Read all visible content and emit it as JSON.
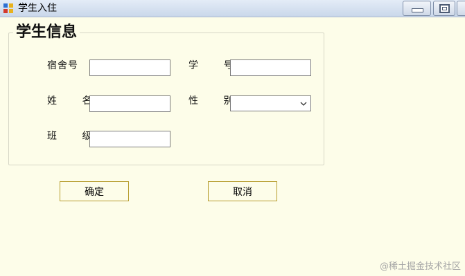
{
  "window": {
    "title": "学生入住"
  },
  "group": {
    "title": "学生信息"
  },
  "fields": {
    "dorm_no": {
      "label": "宿舍号",
      "value": ""
    },
    "student_no": {
      "label": "学 号",
      "value": ""
    },
    "name": {
      "label": "姓 名",
      "value": ""
    },
    "gender": {
      "label": "性 别",
      "value": ""
    },
    "class_name": {
      "label": "班 级",
      "value": ""
    }
  },
  "buttons": {
    "confirm": "确定",
    "cancel": "取消"
  },
  "watermark": "@稀土掘金技术社区",
  "colors": {
    "background": "#fdfde9",
    "button_border": "#b59b2a",
    "titlebar": "#c9d7ea"
  }
}
